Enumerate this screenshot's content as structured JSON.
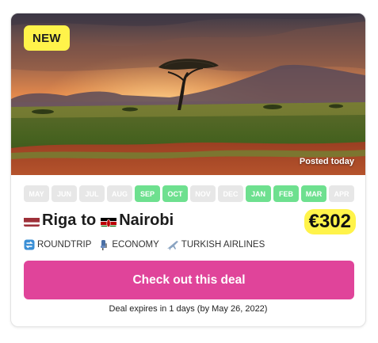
{
  "card": {
    "badge": "NEW",
    "posted": "Posted today",
    "months": [
      {
        "label": "MAY",
        "active": false
      },
      {
        "label": "JUN",
        "active": false
      },
      {
        "label": "JUL",
        "active": false
      },
      {
        "label": "AUG",
        "active": false
      },
      {
        "label": "SEP",
        "active": true
      },
      {
        "label": "OCT",
        "active": true
      },
      {
        "label": "NOV",
        "active": false
      },
      {
        "label": "DEC",
        "active": false
      },
      {
        "label": "JAN",
        "active": true
      },
      {
        "label": "FEB",
        "active": true
      },
      {
        "label": "MAR",
        "active": true
      },
      {
        "label": "APR",
        "active": false
      }
    ],
    "origin": "Riga",
    "connector": "to",
    "destination": "Nairobi",
    "origin_flag_icon": "latvia-flag-icon",
    "destination_flag_icon": "kenya-flag-icon",
    "price": "€302",
    "trip_type": "ROUNDTRIP",
    "cabin": "ECONOMY",
    "airline": "TURKISH AIRLINES",
    "cta_label": "Check out this deal",
    "expires_text": "Deal expires in 1 days (by May 26, 2022)"
  },
  "colors": {
    "accent": "#e0449a",
    "badge": "#fff34a",
    "month_active": "#6ee08f",
    "month_inactive": "#e7e7e7"
  }
}
